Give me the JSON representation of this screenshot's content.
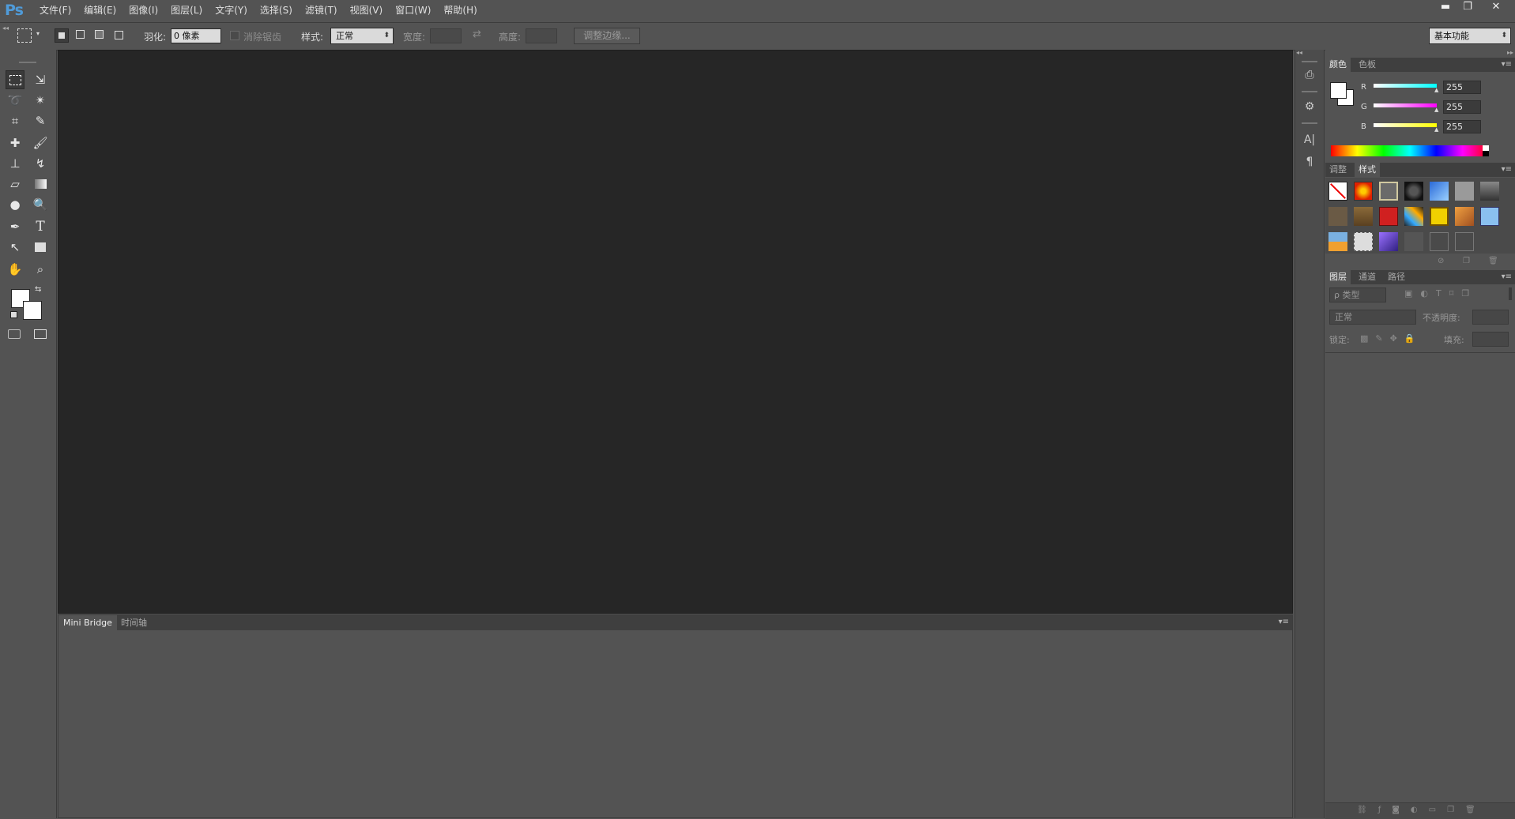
{
  "app": {
    "logo": "Ps"
  },
  "menu": [
    "文件(F)",
    "编辑(E)",
    "图像(I)",
    "图层(L)",
    "文字(Y)",
    "选择(S)",
    "滤镜(T)",
    "视图(V)",
    "窗口(W)",
    "帮助(H)"
  ],
  "window_controls": {
    "minimize": "▬",
    "restore": "❐",
    "close": "✕"
  },
  "options": {
    "feather_label": "羽化:",
    "feather_value": "0 像素",
    "antialias_label": "消除锯齿",
    "style_label": "样式:",
    "style_value": "正常",
    "width_label": "宽度:",
    "swap_icon": "⇄",
    "height_label": "高度:",
    "refine_edge": "调整边缘...",
    "workspace": "基本功能"
  },
  "bottom_tabs": [
    "Mini Bridge",
    "时间轴"
  ],
  "color_panel": {
    "tabs": [
      "颜色",
      "色板"
    ],
    "channels": [
      {
        "label": "R",
        "value": "255",
        "color": "#00ffff"
      },
      {
        "label": "G",
        "value": "255",
        "color": "#ff00ff"
      },
      {
        "label": "B",
        "value": "255",
        "color": "#ffff00"
      }
    ]
  },
  "styles_panel": {
    "tabs": [
      "调整",
      "样式"
    ]
  },
  "layers_panel": {
    "tabs": [
      "图层",
      "通道",
      "路径"
    ],
    "filter_label": "ρ 类型",
    "blend_mode": "正常",
    "opacity_label": "不透明度:",
    "lock_label": "锁定:",
    "fill_label": "填充:"
  },
  "colors": {
    "canvas": "#262626",
    "ui": "#535353",
    "accent": "#4f9bd9"
  }
}
